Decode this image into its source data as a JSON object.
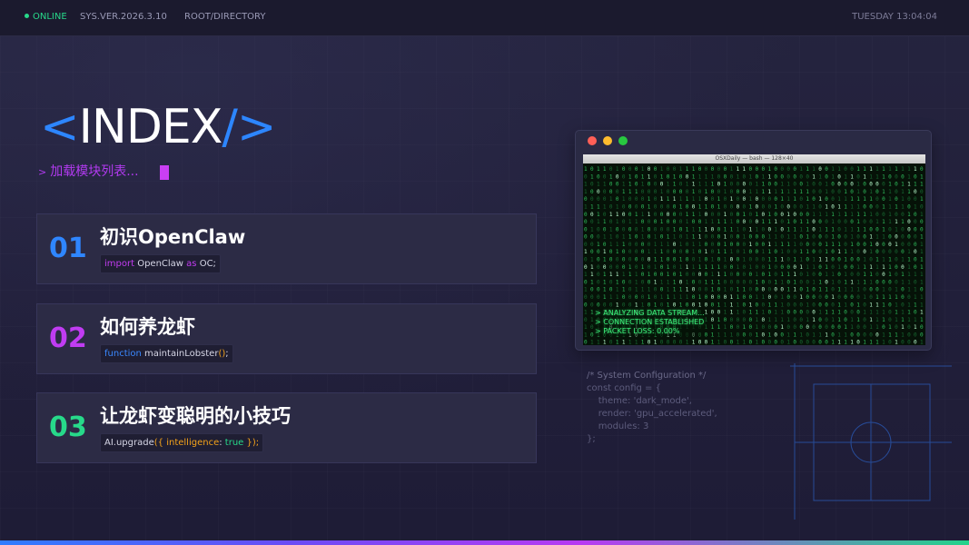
{
  "topbar": {
    "status": "ONLINE",
    "version": "SYS.VER.2026.3.10",
    "path": "ROOT/DIRECTORY",
    "datetime": "TUESDAY 13:04:04"
  },
  "title": {
    "open": "<",
    "word": "INDEX",
    "close": "/>"
  },
  "subtitle": {
    "arrow": ">",
    "text": "加载模块列表..."
  },
  "modules": [
    {
      "number": "01",
      "name": "初识OpenClaw",
      "code": {
        "p1": "import",
        "p2": " OpenClaw ",
        "p3": "as",
        "p4": " OC;"
      }
    },
    {
      "number": "02",
      "name": "如何养龙虾",
      "code": {
        "p1": "function",
        "p2": " maintainLobster",
        "p3": "()",
        "p4": ";"
      }
    },
    {
      "number": "03",
      "name": "让龙虾变聪明的小技巧",
      "code": {
        "p1": "AI.upgrade",
        "p2": "({ ",
        "p3": "intelligence",
        "p4": ": ",
        "p5": "true",
        "p6": " });"
      }
    }
  ],
  "terminal": {
    "window_title": "OSXDaily — bash — 128×40",
    "lines": [
      "> ANALYZING DATA STREAM...",
      "> CONNECTION ESTABLISHED",
      "> PACKET LOSS: 0.00%"
    ]
  },
  "config": {
    "comment": "/* System Configuration */",
    "lines": [
      "const config = {",
      "    theme: 'dark_mode',",
      "    render: 'gpu_accelerated',",
      "    modules: 3",
      "};"
    ]
  },
  "colors": {
    "accent_blue": "#2d86ff",
    "accent_purple": "#b23af0",
    "accent_green": "#27d98a",
    "module_01": "#2f86ff",
    "module_02": "#c03cf2",
    "module_03": "#27d98a"
  }
}
